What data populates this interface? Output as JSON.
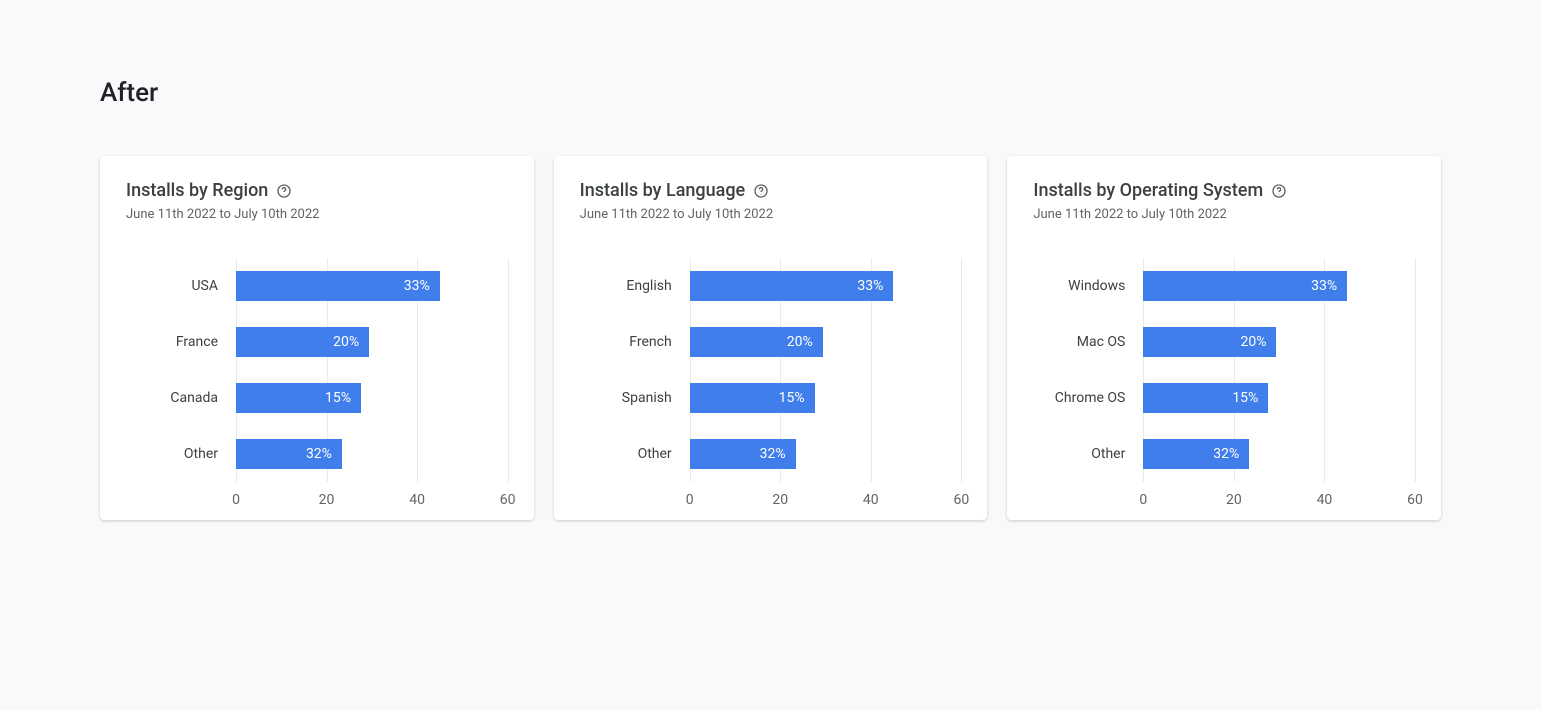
{
  "page_title": "After",
  "date_range": "June 11th 2022 to July 10th 2022",
  "axis": {
    "max": 60,
    "ticks": [
      0,
      20,
      40,
      60
    ]
  },
  "cards": [
    {
      "title": "Installs by Region",
      "rows": [
        {
          "label": "USA",
          "value": 33,
          "label_pct": "33%"
        },
        {
          "label": "France",
          "value": 20,
          "label_pct": "20%"
        },
        {
          "label": "Canada",
          "value": 15,
          "label_pct": "15%"
        },
        {
          "label": "Other",
          "value": 32,
          "label_pct": "32%"
        }
      ]
    },
    {
      "title": "Installs by Language",
      "rows": [
        {
          "label": "English",
          "value": 33,
          "label_pct": "33%"
        },
        {
          "label": "French",
          "value": 20,
          "label_pct": "20%"
        },
        {
          "label": "Spanish",
          "value": 15,
          "label_pct": "15%"
        },
        {
          "label": "Other",
          "value": 32,
          "label_pct": "32%"
        }
      ]
    },
    {
      "title": "Installs by Operating System",
      "rows": [
        {
          "label": "Windows",
          "value": 33,
          "label_pct": "33%"
        },
        {
          "label": "Mac OS",
          "value": 20,
          "label_pct": "20%"
        },
        {
          "label": "Chrome OS",
          "value": 15,
          "label_pct": "15%"
        },
        {
          "label": "Other",
          "value": 32,
          "label_pct": "32%"
        }
      ]
    }
  ],
  "chart_data": [
    {
      "type": "bar",
      "title": "Installs by Region",
      "subtitle": "June 11th 2022 to July 10th 2022",
      "categories": [
        "USA",
        "France",
        "Canada",
        "Other"
      ],
      "values": [
        33,
        20,
        15,
        32
      ],
      "orientation": "horizontal",
      "xlim": [
        0,
        60
      ],
      "xlabel": "",
      "ylabel": ""
    },
    {
      "type": "bar",
      "title": "Installs by Language",
      "subtitle": "June 11th 2022 to July 10th 2022",
      "categories": [
        "English",
        "French",
        "Spanish",
        "Other"
      ],
      "values": [
        33,
        20,
        15,
        32
      ],
      "orientation": "horizontal",
      "xlim": [
        0,
        60
      ],
      "xlabel": "",
      "ylabel": ""
    },
    {
      "type": "bar",
      "title": "Installs by Operating System",
      "subtitle": "June 11th 2022 to July 10th 2022",
      "categories": [
        "Windows",
        "Mac OS",
        "Chrome OS",
        "Other"
      ],
      "values": [
        33,
        20,
        15,
        32
      ],
      "orientation": "horizontal",
      "xlim": [
        0,
        60
      ],
      "xlabel": "",
      "ylabel": ""
    }
  ]
}
